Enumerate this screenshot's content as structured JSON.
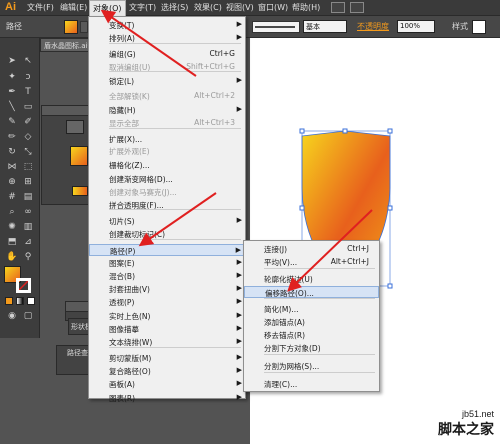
{
  "app": {
    "logo": "Ai"
  },
  "menubar": {
    "items": [
      "文件(F)",
      "编辑(E)",
      "对象(O)",
      "文字(T)",
      "选择(S)",
      "效果(C)",
      "视图(V)",
      "窗口(W)",
      "帮助(H)"
    ]
  },
  "control_bar": {
    "selection_label": "路径",
    "stroke_style": "基本",
    "opacity_label": "不透明度",
    "opacity_value": "100%",
    "style_label": "样式"
  },
  "document": {
    "tab_title": "盾水晶图标.ai*"
  },
  "panels": {
    "shape_panel_title": "形状模",
    "pathfinder_panel_title": "路径查"
  },
  "object_menu": {
    "items": [
      {
        "label": "变换(T)",
        "shortcut": "",
        "submenu": true,
        "disabled": false
      },
      {
        "label": "排列(A)",
        "shortcut": "",
        "submenu": true,
        "disabled": false
      },
      {
        "label": "编组(G)",
        "shortcut": "Ctrl+G",
        "submenu": false,
        "disabled": false
      },
      {
        "label": "取消编组(U)",
        "shortcut": "Shift+Ctrl+G",
        "submenu": false,
        "disabled": true
      },
      {
        "label": "锁定(L)",
        "shortcut": "",
        "submenu": true,
        "disabled": false
      },
      {
        "label": "全部解锁(K)",
        "shortcut": "Alt+Ctrl+2",
        "submenu": false,
        "disabled": true
      },
      {
        "label": "隐藏(H)",
        "shortcut": "",
        "submenu": true,
        "disabled": false
      },
      {
        "label": "显示全部",
        "shortcut": "Alt+Ctrl+3",
        "submenu": false,
        "disabled": true
      },
      {
        "label": "扩展(X)...",
        "shortcut": "",
        "submenu": false,
        "disabled": false
      },
      {
        "label": "扩展外观(E)",
        "shortcut": "",
        "submenu": false,
        "disabled": true
      },
      {
        "label": "栅格化(Z)...",
        "shortcut": "",
        "submenu": false,
        "disabled": false
      },
      {
        "label": "创建渐变网格(D)...",
        "shortcut": "",
        "submenu": false,
        "disabled": false
      },
      {
        "label": "创建对象马赛克(J)...",
        "shortcut": "",
        "submenu": false,
        "disabled": true
      },
      {
        "label": "拼合透明度(F)...",
        "shortcut": "",
        "submenu": false,
        "disabled": false
      },
      {
        "label": "切片(S)",
        "shortcut": "",
        "submenu": true,
        "disabled": false
      },
      {
        "label": "创建裁切标记(C)",
        "shortcut": "",
        "submenu": false,
        "disabled": false
      },
      {
        "label": "路径(P)",
        "shortcut": "",
        "submenu": true,
        "disabled": false
      },
      {
        "label": "图案(E)",
        "shortcut": "",
        "submenu": true,
        "disabled": false
      },
      {
        "label": "混合(B)",
        "shortcut": "",
        "submenu": true,
        "disabled": false
      },
      {
        "label": "封套扭曲(V)",
        "shortcut": "",
        "submenu": true,
        "disabled": false
      },
      {
        "label": "透视(P)",
        "shortcut": "",
        "submenu": true,
        "disabled": false
      },
      {
        "label": "实时上色(N)",
        "shortcut": "",
        "submenu": true,
        "disabled": false
      },
      {
        "label": "图像描摹",
        "shortcut": "",
        "submenu": true,
        "disabled": false
      },
      {
        "label": "文本绕排(W)",
        "shortcut": "",
        "submenu": true,
        "disabled": false
      },
      {
        "label": "剪切蒙版(M)",
        "shortcut": "",
        "submenu": true,
        "disabled": false
      },
      {
        "label": "复合路径(O)",
        "shortcut": "",
        "submenu": true,
        "disabled": false
      },
      {
        "label": "画板(A)",
        "shortcut": "",
        "submenu": true,
        "disabled": false
      },
      {
        "label": "图表(R)",
        "shortcut": "",
        "submenu": true,
        "disabled": false
      }
    ]
  },
  "path_submenu": {
    "items": [
      {
        "label": "连接(J)",
        "shortcut": "Ctrl+J"
      },
      {
        "label": "平均(V)...",
        "shortcut": "Alt+Ctrl+J"
      },
      {
        "label": "轮廓化描边(U)",
        "shortcut": ""
      },
      {
        "label": "偏移路径(O)...",
        "shortcut": ""
      },
      {
        "label": "简化(M)...",
        "shortcut": ""
      },
      {
        "label": "添加锚点(A)",
        "shortcut": ""
      },
      {
        "label": "移去锚点(R)",
        "shortcut": ""
      },
      {
        "label": "分割下方对象(D)",
        "shortcut": ""
      },
      {
        "label": "分割为网格(S)...",
        "shortcut": ""
      },
      {
        "label": "清理(C)...",
        "shortcut": ""
      }
    ]
  },
  "watermark": {
    "site": "jb51.net",
    "name": "脚本之家"
  },
  "colors": {
    "accent": "#f39a1c",
    "arrow": "#e02020",
    "menu_bg": "#f0f0f0",
    "highlight": "#d6e3f5",
    "shield_yellow": "#f7d51d",
    "shield_orange": "#e8601c"
  }
}
